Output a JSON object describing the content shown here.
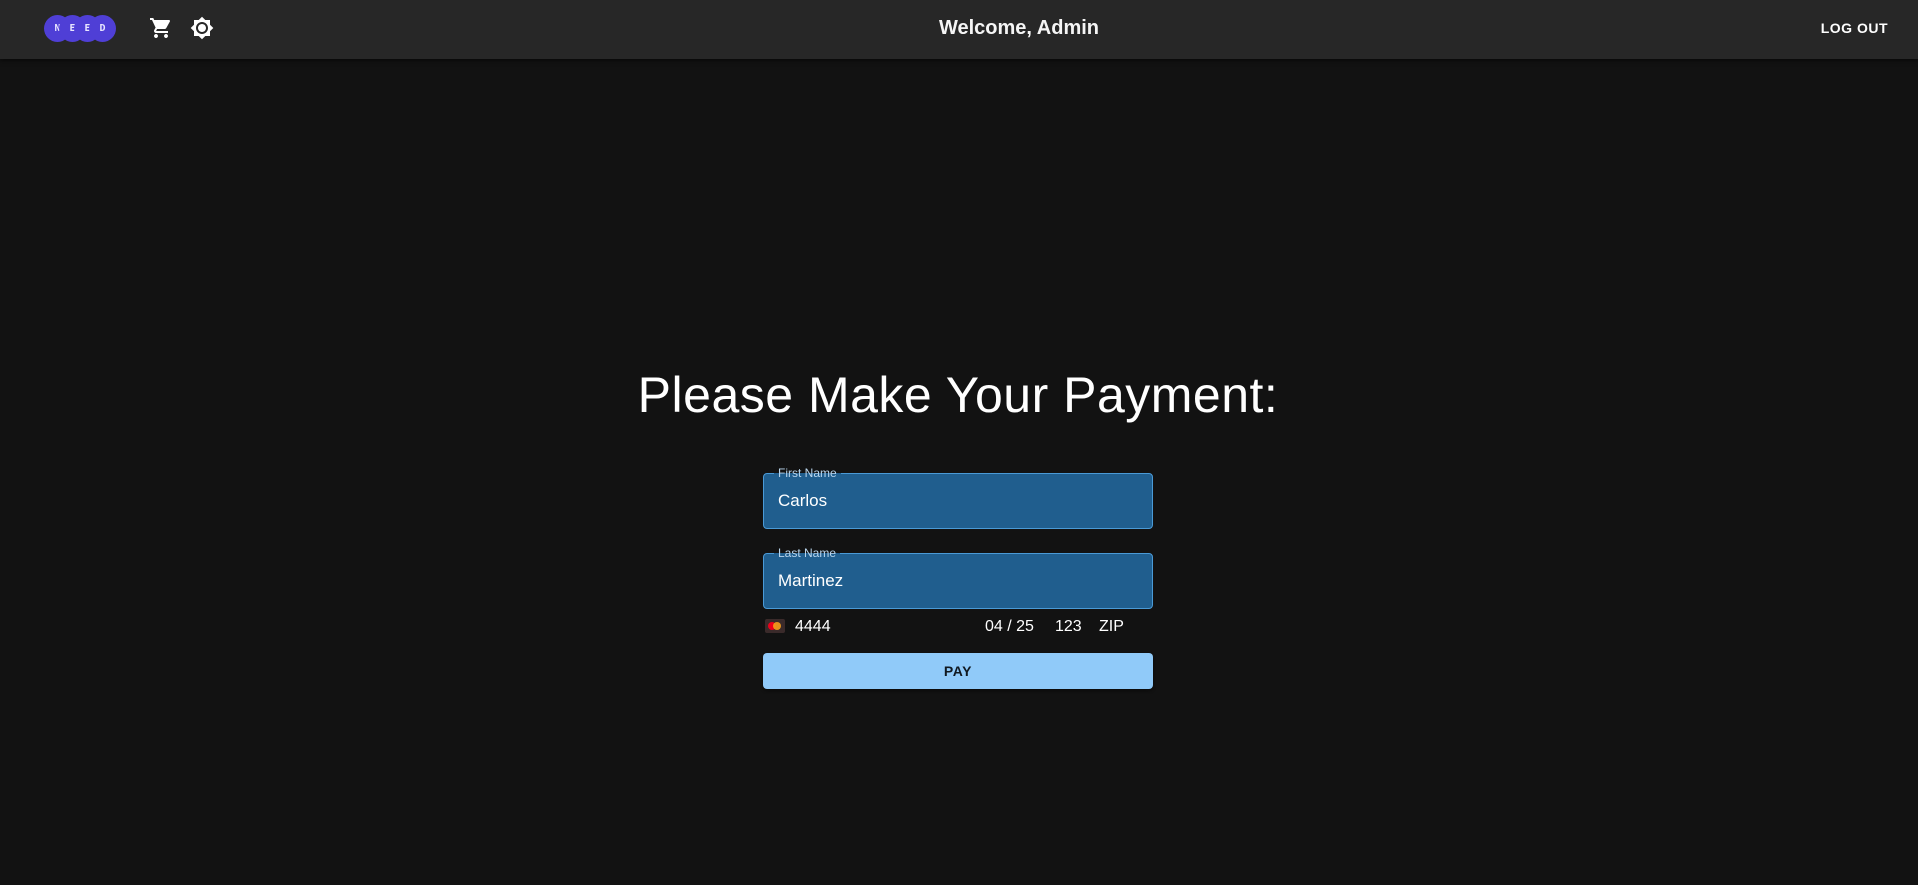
{
  "appbar": {
    "logo_letters": [
      "N",
      "E",
      "E",
      "D"
    ],
    "cart_icon": "shopping-cart-icon",
    "theme_icon": "brightness-icon",
    "welcome": "Welcome, Admin",
    "logout_label": "LOG OUT"
  },
  "main": {
    "title": "Please Make Your Payment:",
    "first_name": {
      "label": "First Name",
      "value": "Carlos"
    },
    "last_name": {
      "label": "Last Name",
      "value": "Martinez"
    },
    "card": {
      "brand_icon": "mastercard-icon",
      "number": "4444",
      "expiry": "04 / 25",
      "cvc": "123",
      "zip_placeholder": "ZIP"
    },
    "pay_label": "PAY"
  },
  "colors": {
    "background": "#121212",
    "appbar": "#272727",
    "field_fill": "#205e8e",
    "pay_button": "#90caf9",
    "logo": "#4f3fd6"
  }
}
